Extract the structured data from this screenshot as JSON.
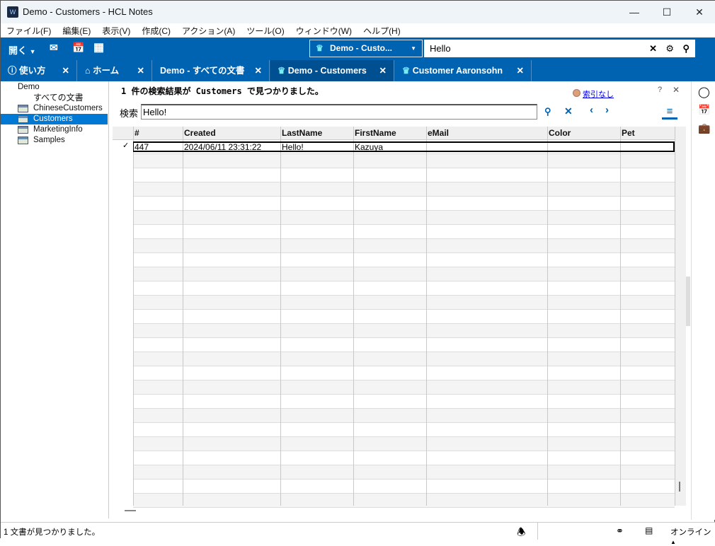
{
  "window": {
    "title": "Demo - Customers - HCL Notes"
  },
  "menu": [
    "ファイル(F)",
    "編集(E)",
    "表示(V)",
    "作成(C)",
    "アクション(A)",
    "ツール(O)",
    "ウィンドウ(W)",
    "ヘルプ(H)"
  ],
  "toolbar": {
    "open_label": "開く",
    "db_selector": "Demo - Custo...",
    "search_value": "Hello"
  },
  "tabs": [
    {
      "label": "使い方"
    },
    {
      "label": "ホーム"
    },
    {
      "label": "Demo - すべての文書"
    },
    {
      "label": "Demo - Customers"
    },
    {
      "label": "Customer Aaronsohn"
    }
  ],
  "nav": {
    "root": "Demo",
    "items": [
      "すべての文書",
      "ChineseCustomers",
      "Customers",
      "MarketingInfo",
      "Samples"
    ]
  },
  "search": {
    "result_message": "1 件の検索結果が Customers で見つかりました。",
    "index_link": "索引なし",
    "help": "?",
    "label": "検索",
    "query": "Hello!"
  },
  "grid": {
    "columns": [
      "#",
      "Created",
      "LastName",
      "FirstName",
      "eMail",
      "Color",
      "Pet"
    ],
    "rows": [
      [
        "447",
        "2024/06/11 23:31:22",
        "Hello!",
        "Kazuya",
        "",
        "",
        ""
      ]
    ]
  },
  "status": {
    "message": "1 文書が見つかりました。",
    "online": "オンライン"
  }
}
